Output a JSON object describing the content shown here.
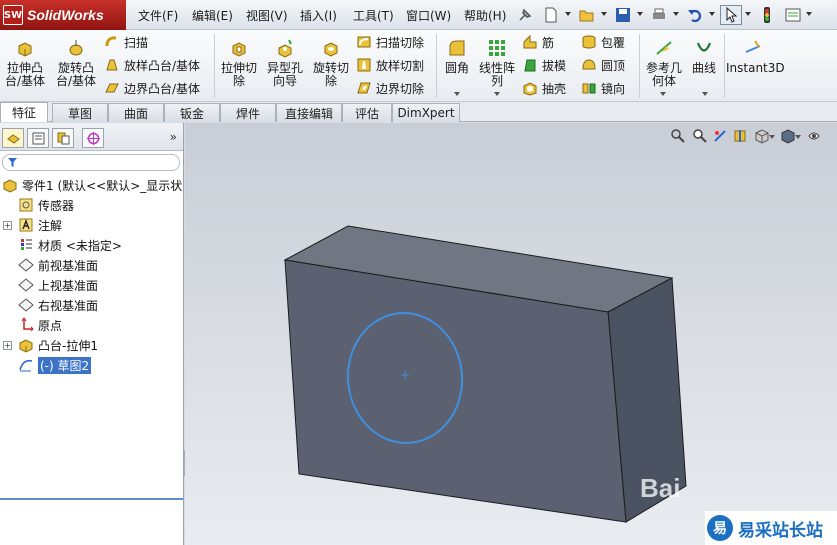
{
  "app": {
    "logo_badge": "SW",
    "logo_name": "SolidWorks"
  },
  "menu": [
    "文件(F)",
    "编辑(E)",
    "视图(V)",
    "插入(I)",
    "工具(T)",
    "窗口(W)",
    "帮助(H)"
  ],
  "ribbon": {
    "extrude_boss": "拉伸凸\n台/基体",
    "revolve_boss": "旋转凸\n台/基体",
    "sweep": "扫描",
    "loft_boss": "放样凸台/基体",
    "boundary_boss": "边界凸台/基体",
    "extrude_cut": "拉伸切\n除",
    "hole_wizard": "异型孔\n向导",
    "revolve_cut": "旋转切\n除",
    "sweep_cut": "扫描切除",
    "loft_cut": "放样切割",
    "boundary_cut": "边界切除",
    "fillet": "圆角",
    "linear_pattern": "线性阵\n列",
    "rib": "筋",
    "draft": "拔模",
    "shell": "抽壳",
    "wrap": "包覆",
    "dome": "圆顶",
    "mirror": "镜向",
    "ref_geometry": "参考几\n何体",
    "curves": "曲线",
    "instant3d": "Instant3D"
  },
  "tabs": [
    "特征",
    "草图",
    "曲面",
    "钣金",
    "焊件",
    "直接编辑",
    "评估",
    "DimXpert"
  ],
  "panel": {
    "more": "»"
  },
  "tree": [
    {
      "label": "零件1 (默认<<默认>_显示状态"
    },
    {
      "label": "传感器"
    },
    {
      "label": "注解"
    },
    {
      "label": "材质 <未指定>"
    },
    {
      "label": "前视基准面"
    },
    {
      "label": "上视基准面"
    },
    {
      "label": "右视基准面"
    },
    {
      "label": "原点"
    },
    {
      "label": "凸台-拉伸1"
    },
    {
      "label": "(-) 草图2"
    }
  ],
  "watermark": {
    "bai": "Bai",
    "site_logo": "易",
    "site_text": "易采站长站"
  },
  "colors": {
    "accent": "#3c73c7",
    "logo_red": "#b41e19",
    "sketch_blue": "#3f8fe0"
  }
}
